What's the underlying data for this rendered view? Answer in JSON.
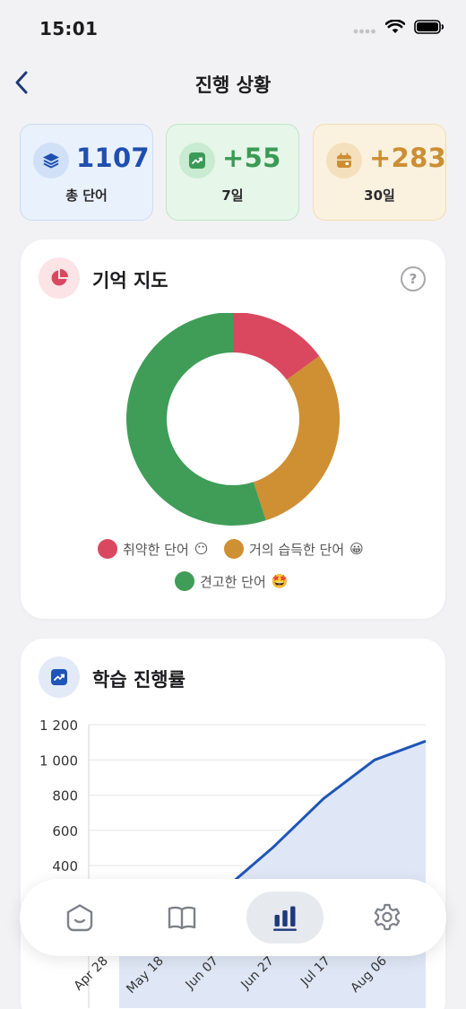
{
  "status_bar": {
    "time": "15:01"
  },
  "nav": {
    "title": "진행 상황"
  },
  "stats": [
    {
      "value": "1107",
      "label": "총 단어",
      "icon": "layers-icon",
      "color": "#1f4fae",
      "bg": "#e9f1fc",
      "border": "#c9dbf3",
      "icon_bg": "#cfe0f7"
    },
    {
      "value": "+55",
      "label": "7일",
      "icon": "trend-icon",
      "color": "#3b9a55",
      "bg": "#e6f6e9",
      "border": "#bfe6c8",
      "icon_bg": "#c8ebd1"
    },
    {
      "value": "+283",
      "label": "30일",
      "icon": "calendar-icon",
      "color": "#cb8f33",
      "bg": "#fbf1df",
      "border": "#f2dcb4",
      "icon_bg": "#f5e0bd"
    }
  ],
  "memory_map": {
    "title": "기억 지도",
    "help": "?",
    "legend": [
      {
        "label": "취약한 단어",
        "emoji": "😶",
        "color": "#d9485f"
      },
      {
        "label": "거의 습득한 단어",
        "emoji": "😀",
        "color": "#cf8f33"
      },
      {
        "label": "견고한 단어",
        "emoji": "🤩",
        "color": "#3f9d58"
      }
    ]
  },
  "progress": {
    "title": "학습 진행률"
  },
  "chart_data": [
    {
      "type": "pie",
      "categories": [
        "취약한 단어",
        "거의 습득한 단어",
        "견고한 단어"
      ],
      "values": [
        15,
        30,
        55
      ],
      "colors": [
        "#d9485f",
        "#cf8f33",
        "#3f9d58"
      ],
      "donut": true
    },
    {
      "type": "area",
      "x": [
        "Apr 28",
        "May 18",
        "Jun 07",
        "Jun 27",
        "Jul 17",
        "Aug 06"
      ],
      "xlabel": "",
      "ylabel": "",
      "yticks": [
        "1 200",
        "1 000",
        "800",
        "600",
        "400"
      ],
      "ylim": [
        0,
        1200
      ],
      "series": [
        {
          "values": [
            0,
            40,
            250,
            500,
            780,
            1000,
            1107
          ]
        }
      ],
      "line_color": "#1f55b8",
      "fill_color": "#dfe7f6",
      "grid": true
    }
  ],
  "tab_bar": {
    "tabs": [
      {
        "name": "home",
        "icon": "home-icon",
        "active": false
      },
      {
        "name": "book",
        "icon": "book-icon",
        "active": false
      },
      {
        "name": "stats",
        "icon": "bar-chart-icon",
        "active": true
      },
      {
        "name": "settings",
        "icon": "settings-icon",
        "active": false
      }
    ]
  }
}
